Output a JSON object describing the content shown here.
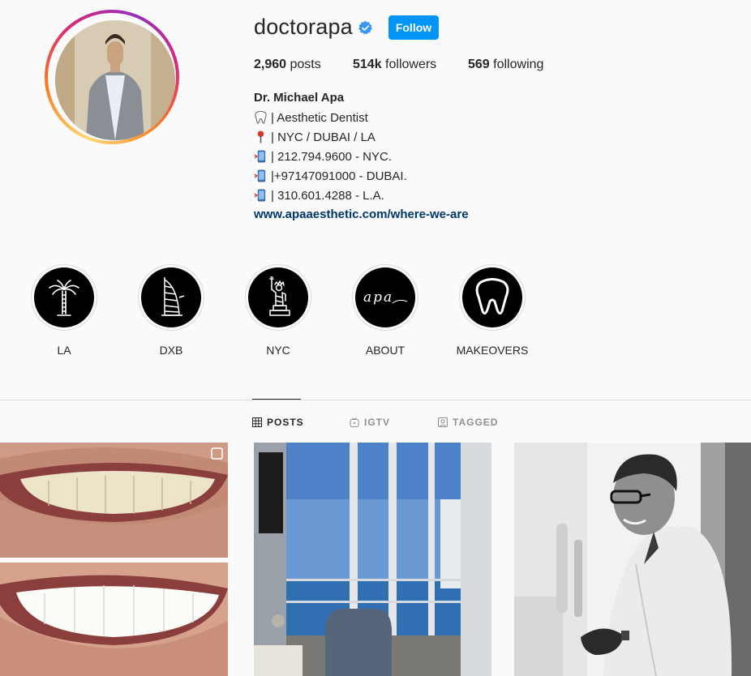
{
  "profile": {
    "username": "doctorapa",
    "verified": true,
    "follow_label": "Follow",
    "stats": {
      "posts_count": "2,960",
      "posts_label": "posts",
      "followers_count": "514k",
      "followers_label": "followers",
      "following_count": "569",
      "following_label": "following"
    },
    "full_name": "Dr. Michael Apa",
    "bio_lines": [
      {
        "icon": "tooth-icon",
        "text": "| Aesthetic Dentist"
      },
      {
        "icon": "pin-icon",
        "text": "| NYC / DUBAI / LA"
      },
      {
        "icon": "phone-icon",
        "text": "| 212.794.9600 - NYC."
      },
      {
        "icon": "phone-icon",
        "text": "|+97147091000 - DUBAI."
      },
      {
        "icon": "phone-icon",
        "text": "| 310.601.4288 - L.A."
      }
    ],
    "website": "www.apaaesthetic.com/where-we-are"
  },
  "highlights": [
    {
      "label": "LA",
      "icon": "palm-tree-icon"
    },
    {
      "label": "DXB",
      "icon": "burj-al-arab-icon"
    },
    {
      "label": "NYC",
      "icon": "statue-of-liberty-icon"
    },
    {
      "label": "ABOUT",
      "icon": "apa-logo"
    },
    {
      "label": "MAKEOVERS",
      "icon": "tooth-icon"
    }
  ],
  "tabs": [
    {
      "label": "POSTS",
      "icon": "grid-icon",
      "active": true
    },
    {
      "label": "IGTV",
      "icon": "igtv-icon",
      "active": false
    },
    {
      "label": "TAGGED",
      "icon": "tagged-icon",
      "active": false
    }
  ],
  "posts": [
    {
      "kind": "smile-before-after",
      "multi": true
    },
    {
      "kind": "ocean-view-room",
      "multi": false
    },
    {
      "kind": "portrait-bw",
      "multi": false
    }
  ],
  "colors": {
    "follow_button": "#0095f6",
    "verified_badge": "#3897f0",
    "link": "#00376b"
  },
  "highlight_logo_text": "apa"
}
